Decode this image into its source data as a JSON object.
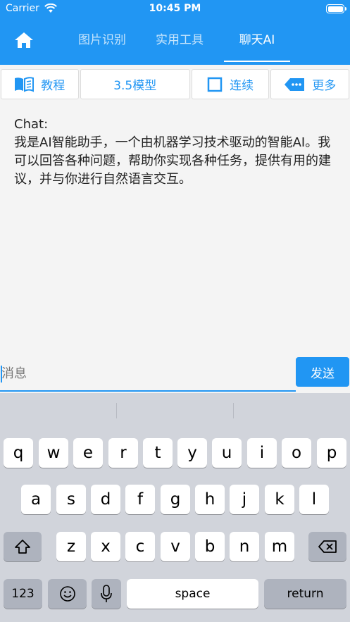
{
  "status": {
    "carrier": "Carrier",
    "time": "10:45 PM"
  },
  "nav": {
    "tabs": [
      "图片识别",
      "实用工具",
      "聊天AI"
    ]
  },
  "toolbar": {
    "tutorial": "教程",
    "model": "3.5模型",
    "continuous": "连续",
    "more": "更多"
  },
  "chat": {
    "label": "Chat:",
    "message": "我是AI智能助手，一个由机器学习技术驱动的智能AI。我可以回答各种问题，帮助你实现各种任务，提供有用的建议，并与你进行自然语言交互。"
  },
  "input": {
    "placeholder": "消息",
    "value": "",
    "send": "发送"
  },
  "keyboard": {
    "row1": [
      "q",
      "w",
      "e",
      "r",
      "t",
      "y",
      "u",
      "i",
      "o",
      "p"
    ],
    "row2": [
      "a",
      "s",
      "d",
      "f",
      "g",
      "h",
      "j",
      "k",
      "l"
    ],
    "row3": [
      "z",
      "x",
      "c",
      "v",
      "b",
      "n",
      "m"
    ],
    "numbers": "123",
    "space": "space",
    "return": "return"
  },
  "colors": {
    "accent": "#2196f3",
    "keyboard_bg": "#d1d4db"
  }
}
